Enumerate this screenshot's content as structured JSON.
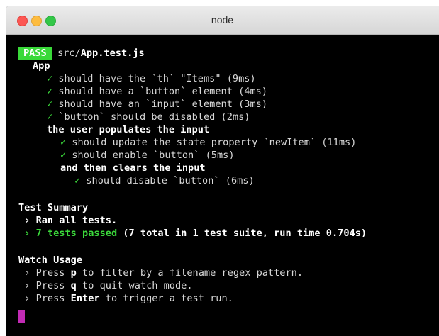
{
  "window": {
    "title": "node"
  },
  "result": {
    "badge": "PASS",
    "path_dir": "src/",
    "path_file": "App.test.js"
  },
  "suite": {
    "name": "App",
    "tests": [
      "should have the `th` \"Items\" (9ms)",
      "should have a `button` element (4ms)",
      "should have an `input` element (3ms)",
      "`button` should be disabled (2ms)"
    ],
    "group1": {
      "name": "the user populates the input",
      "tests": [
        "should update the state property `newItem` (11ms)",
        "should enable `button` (5ms)"
      ],
      "group2": {
        "name": "and then clears the input",
        "tests": [
          "should disable `button` (6ms)"
        ]
      }
    },
    "check_glyph": "✓"
  },
  "summary": {
    "heading": "Test Summary",
    "ran": "Ran all tests.",
    "passed": "7 tests passed",
    "details": "(7 total in 1 test suite, run time 0.704s)"
  },
  "watch": {
    "heading": "Watch Usage",
    "line1_pre": "Press ",
    "line1_key": "p",
    "line1_post": " to filter by a filename regex pattern.",
    "line2_pre": "Press ",
    "line2_key": "q",
    "line2_post": " to quit watch mode.",
    "line3_pre": "Press ",
    "line3_key": "Enter",
    "line3_post": " to trigger a test run."
  },
  "prompt_glyph": "›",
  "colors": {
    "pass_green": "#39d939",
    "cursor_magenta": "#c22bb5",
    "background": "#000000"
  }
}
